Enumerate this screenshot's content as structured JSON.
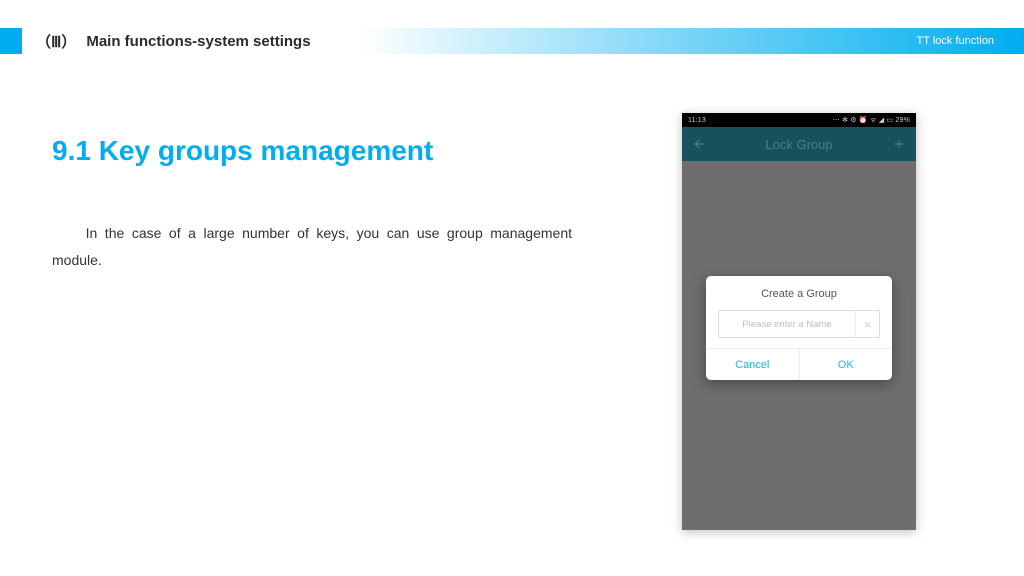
{
  "header": {
    "chapter": "（Ⅲ）",
    "title": "Main functions-system settings",
    "right": "TT lock function"
  },
  "section": {
    "heading": "9.1 Key groups management",
    "body": "In the case of a large number of keys, you can use group management module."
  },
  "phone": {
    "status": {
      "time": "11:13",
      "icons": "⋯ ✻ ⚙ ⏰ ᯤ ◢ ▭ 29%"
    },
    "appbar": {
      "title": "Lock Group"
    },
    "dialog": {
      "title": "Create a Group",
      "placeholder": "Please enter a Name",
      "cancel": "Cancel",
      "ok": "OK"
    }
  }
}
